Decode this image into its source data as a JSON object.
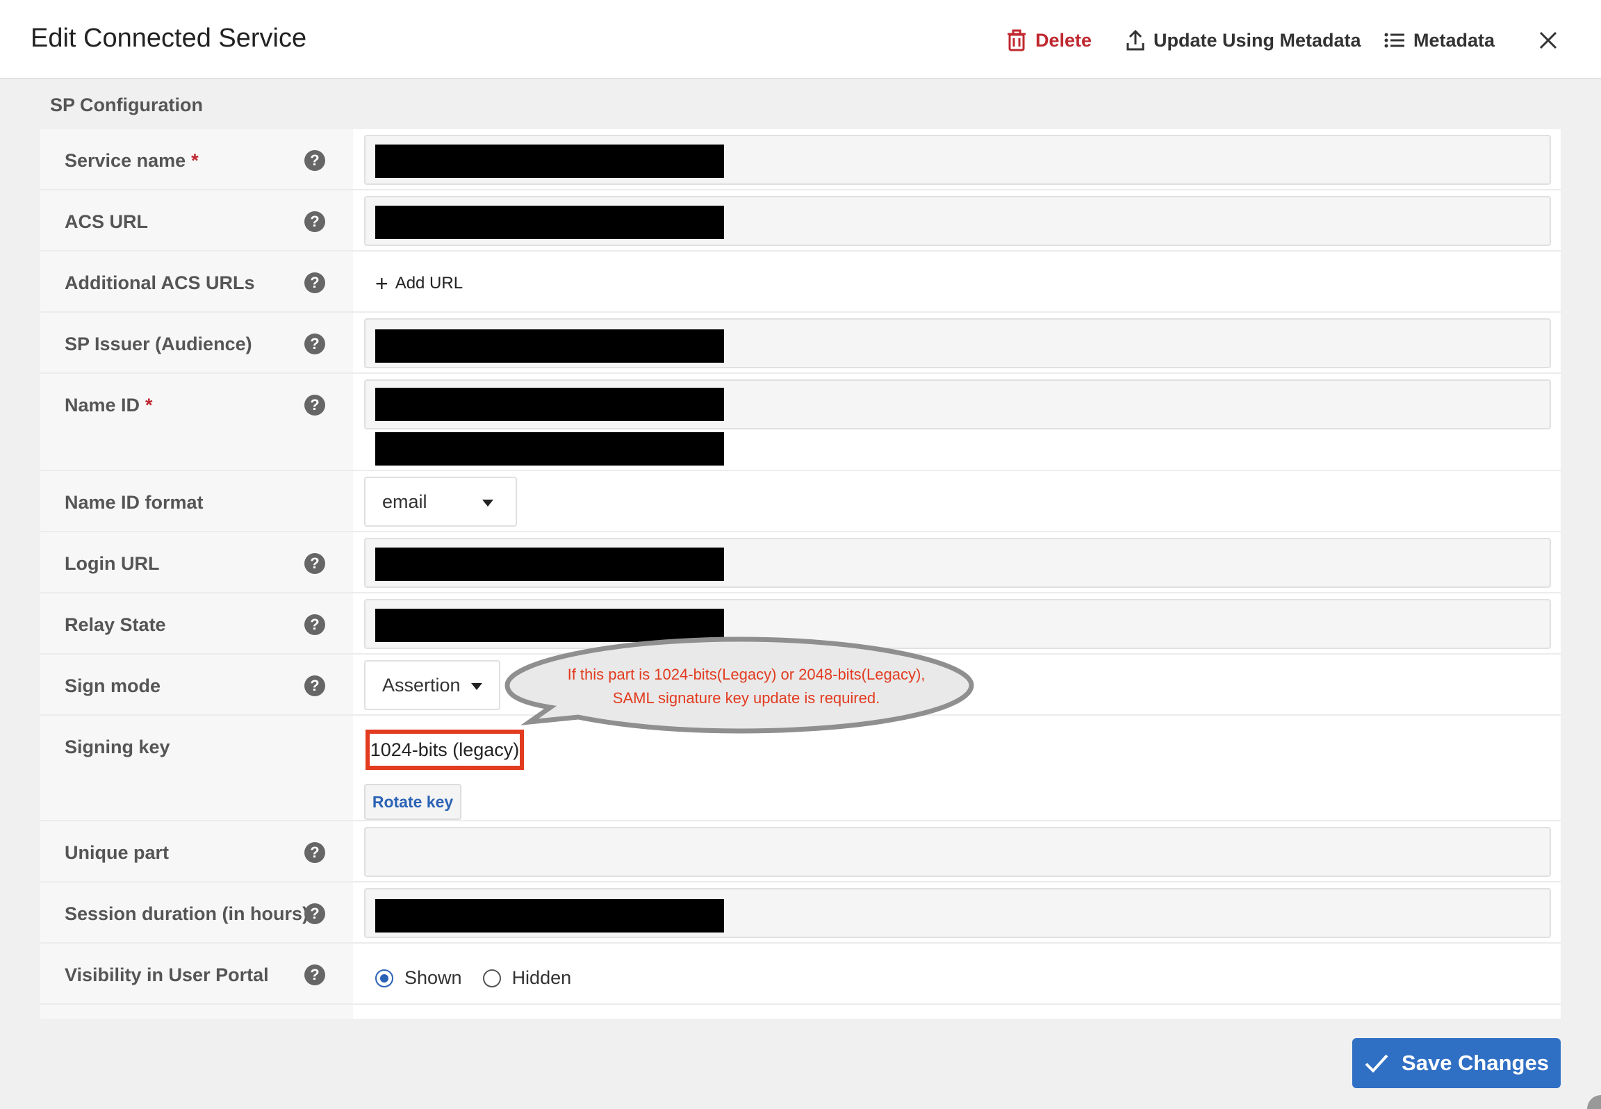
{
  "header": {
    "title": "Edit Connected Service",
    "delete_label": "Delete",
    "update_label": "Update Using Metadata",
    "metadata_label": "Metadata"
  },
  "section": {
    "title": "SP Configuration"
  },
  "fields": {
    "service_name": {
      "label": "Service name",
      "required": "*"
    },
    "acs_url": {
      "label": "ACS URL"
    },
    "additional_acs_urls": {
      "label": "Additional ACS URLs",
      "add_label": "Add URL"
    },
    "sp_issuer": {
      "label": "SP Issuer (Audience)"
    },
    "name_id": {
      "label": "Name ID",
      "required": "*"
    },
    "name_id_format": {
      "label": "Name ID format",
      "value": "email"
    },
    "login_url": {
      "label": "Login URL"
    },
    "relay_state": {
      "label": "Relay State"
    },
    "sign_mode": {
      "label": "Sign mode",
      "value": "Assertion"
    },
    "signing_key": {
      "label": "Signing key",
      "value": "1024-bits (legacy)",
      "rotate_label": "Rotate key"
    },
    "unique_part": {
      "label": "Unique part"
    },
    "session_duration": {
      "label": "Session duration (in hours)"
    },
    "visibility": {
      "label": "Visibility in User Portal",
      "options": [
        "Shown",
        "Hidden"
      ],
      "selected": "Shown"
    }
  },
  "help_glyph": "?",
  "annotation": {
    "line1": "If this part is 1024-bits(Legacy) or 2048-bits(Legacy),",
    "line2": "SAML signature key update is required.",
    "color": "#e23b1f"
  },
  "footer": {
    "save_label": "Save Changes"
  },
  "colors": {
    "accent": "#2f6fc4",
    "danger": "#c0282f"
  }
}
